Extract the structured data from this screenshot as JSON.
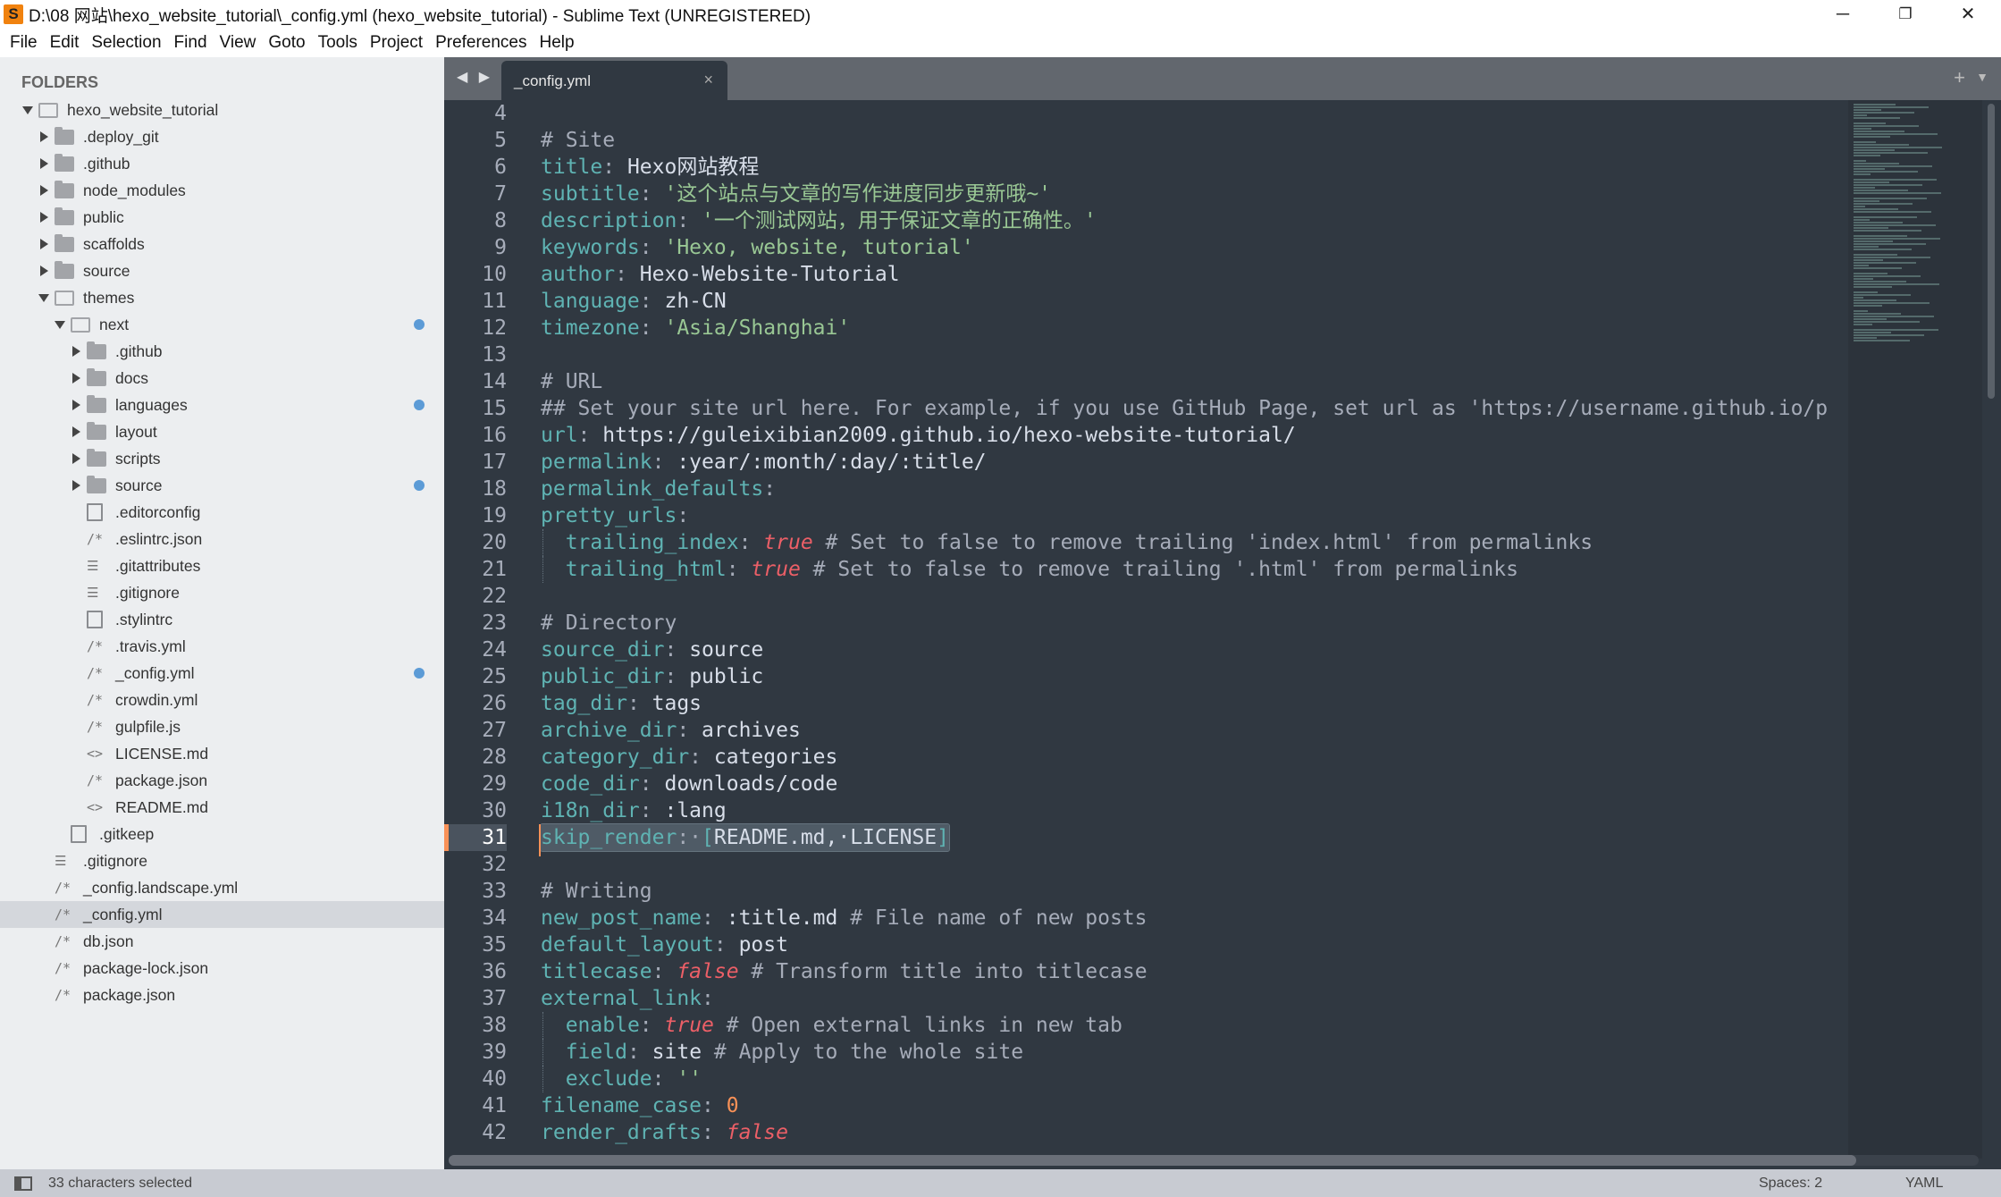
{
  "window": {
    "title": "D:\\08 网站\\hexo_website_tutorial\\_config.yml (hexo_website_tutorial) - Sublime Text (UNREGISTERED)",
    "app_icon": "S",
    "minimize": "─",
    "restore": "❐",
    "close": "✕"
  },
  "menu": [
    "File",
    "Edit",
    "Selection",
    "Find",
    "View",
    "Goto",
    "Tools",
    "Project",
    "Preferences",
    "Help"
  ],
  "sidebar": {
    "header": "FOLDERS",
    "items": [
      {
        "label": "hexo_website_tutorial",
        "level": 0,
        "type": "folder-open",
        "expanded": true
      },
      {
        "label": ".deploy_git",
        "level": 1,
        "type": "folder"
      },
      {
        "label": ".github",
        "level": 1,
        "type": "folder"
      },
      {
        "label": "node_modules",
        "level": 1,
        "type": "folder"
      },
      {
        "label": "public",
        "level": 1,
        "type": "folder"
      },
      {
        "label": "scaffolds",
        "level": 1,
        "type": "folder"
      },
      {
        "label": "source",
        "level": 1,
        "type": "folder"
      },
      {
        "label": "themes",
        "level": 1,
        "type": "folder-open",
        "expanded": true
      },
      {
        "label": "next",
        "level": 2,
        "type": "folder-open",
        "expanded": true,
        "modified": true
      },
      {
        "label": ".github",
        "level": 3,
        "type": "folder"
      },
      {
        "label": "docs",
        "level": 3,
        "type": "folder"
      },
      {
        "label": "languages",
        "level": 3,
        "type": "folder",
        "modified": true
      },
      {
        "label": "layout",
        "level": 3,
        "type": "folder"
      },
      {
        "label": "scripts",
        "level": 3,
        "type": "folder"
      },
      {
        "label": "source",
        "level": 3,
        "type": "folder",
        "modified": true
      },
      {
        "label": ".editorconfig",
        "level": 3,
        "type": "doc"
      },
      {
        "label": ".eslintrc.json",
        "level": 3,
        "type": "code",
        "glyph": "/*"
      },
      {
        "label": ".gitattributes",
        "level": 3,
        "type": "text",
        "glyph": "☰"
      },
      {
        "label": ".gitignore",
        "level": 3,
        "type": "text",
        "glyph": "☰"
      },
      {
        "label": ".stylintrc",
        "level": 3,
        "type": "doc"
      },
      {
        "label": ".travis.yml",
        "level": 3,
        "type": "code",
        "glyph": "/*"
      },
      {
        "label": "_config.yml",
        "level": 3,
        "type": "code",
        "glyph": "/*",
        "modified": true
      },
      {
        "label": "crowdin.yml",
        "level": 3,
        "type": "code",
        "glyph": "/*"
      },
      {
        "label": "gulpfile.js",
        "level": 3,
        "type": "code",
        "glyph": "/*"
      },
      {
        "label": "LICENSE.md",
        "level": 3,
        "type": "markup",
        "glyph": "<>"
      },
      {
        "label": "package.json",
        "level": 3,
        "type": "code",
        "glyph": "/*"
      },
      {
        "label": "README.md",
        "level": 3,
        "type": "markup",
        "glyph": "<>"
      },
      {
        "label": ".gitkeep",
        "level": 2,
        "type": "doc"
      },
      {
        "label": ".gitignore",
        "level": 1,
        "type": "text",
        "glyph": "☰"
      },
      {
        "label": "_config.landscape.yml",
        "level": 1,
        "type": "code",
        "glyph": "/*"
      },
      {
        "label": "_config.yml",
        "level": 1,
        "type": "code",
        "glyph": "/*",
        "selected": true
      },
      {
        "label": "db.json",
        "level": 1,
        "type": "code",
        "glyph": "/*"
      },
      {
        "label": "package-lock.json",
        "level": 1,
        "type": "code",
        "glyph": "/*"
      },
      {
        "label": "package.json",
        "level": 1,
        "type": "code",
        "glyph": "/*"
      }
    ]
  },
  "tabs": {
    "nav": "◀ ▶",
    "active": "_config.yml",
    "close": "×",
    "plus": "+",
    "menu": "▼"
  },
  "editor": {
    "current_line": 31,
    "lines": [
      {
        "n": 4,
        "t": []
      },
      {
        "n": 5,
        "t": [
          [
            "cmt",
            "# Site"
          ]
        ]
      },
      {
        "n": 6,
        "t": [
          [
            "key",
            "title"
          ],
          [
            "pun",
            ": "
          ],
          [
            "val",
            "Hexo网站教程"
          ]
        ]
      },
      {
        "n": 7,
        "t": [
          [
            "key",
            "subtitle"
          ],
          [
            "pun",
            ": "
          ],
          [
            "str",
            "'这个站点与文章的写作进度同步更新哦~'"
          ]
        ]
      },
      {
        "n": 8,
        "t": [
          [
            "key",
            "description"
          ],
          [
            "pun",
            ": "
          ],
          [
            "str",
            "'一个测试网站，用于保证文章的正确性。'"
          ]
        ]
      },
      {
        "n": 9,
        "t": [
          [
            "key",
            "keywords"
          ],
          [
            "pun",
            ": "
          ],
          [
            "str",
            "'Hexo, website, tutorial'"
          ]
        ]
      },
      {
        "n": 10,
        "t": [
          [
            "key",
            "author"
          ],
          [
            "pun",
            ": "
          ],
          [
            "val",
            "Hexo-Website-Tutorial"
          ]
        ]
      },
      {
        "n": 11,
        "t": [
          [
            "key",
            "language"
          ],
          [
            "pun",
            ": "
          ],
          [
            "val",
            "zh-CN"
          ]
        ]
      },
      {
        "n": 12,
        "t": [
          [
            "key",
            "timezone"
          ],
          [
            "pun",
            ": "
          ],
          [
            "str",
            "'Asia/Shanghai'"
          ]
        ]
      },
      {
        "n": 13,
        "t": []
      },
      {
        "n": 14,
        "t": [
          [
            "cmt",
            "# URL"
          ]
        ]
      },
      {
        "n": 15,
        "t": [
          [
            "cmt",
            "## Set your site url here. For example, if you use GitHub Page, set url as 'https://username.github.io/p"
          ]
        ]
      },
      {
        "n": 16,
        "t": [
          [
            "key",
            "url"
          ],
          [
            "pun",
            ": "
          ],
          [
            "val",
            "https://guleixibian2009.github.io/hexo-website-tutorial/"
          ]
        ]
      },
      {
        "n": 17,
        "t": [
          [
            "key",
            "permalink"
          ],
          [
            "pun",
            ": "
          ],
          [
            "val",
            ":year/:month/:day/:title/"
          ]
        ]
      },
      {
        "n": 18,
        "t": [
          [
            "key",
            "permalink_defaults"
          ],
          [
            "pun",
            ":"
          ]
        ]
      },
      {
        "n": 19,
        "t": [
          [
            "key",
            "pretty_urls"
          ],
          [
            "pun",
            ":"
          ]
        ]
      },
      {
        "n": 20,
        "indent": true,
        "t": [
          [
            "val",
            "  "
          ],
          [
            "key",
            "trailing_index"
          ],
          [
            "pun",
            ": "
          ],
          [
            "bool",
            "true"
          ],
          [
            "cmt",
            " # Set to false to remove trailing 'index.html' from permalinks"
          ]
        ]
      },
      {
        "n": 21,
        "indent": true,
        "t": [
          [
            "val",
            "  "
          ],
          [
            "key",
            "trailing_html"
          ],
          [
            "pun",
            ": "
          ],
          [
            "bool",
            "true"
          ],
          [
            "cmt",
            " # Set to false to remove trailing '.html' from permalinks"
          ]
        ]
      },
      {
        "n": 22,
        "t": []
      },
      {
        "n": 23,
        "t": [
          [
            "cmt",
            "# Directory"
          ]
        ]
      },
      {
        "n": 24,
        "t": [
          [
            "key",
            "source_dir"
          ],
          [
            "pun",
            ": "
          ],
          [
            "val",
            "source"
          ]
        ]
      },
      {
        "n": 25,
        "t": [
          [
            "key",
            "public_dir"
          ],
          [
            "pun",
            ": "
          ],
          [
            "val",
            "public"
          ]
        ]
      },
      {
        "n": 26,
        "t": [
          [
            "key",
            "tag_dir"
          ],
          [
            "pun",
            ": "
          ],
          [
            "val",
            "tags"
          ]
        ]
      },
      {
        "n": 27,
        "t": [
          [
            "key",
            "archive_dir"
          ],
          [
            "pun",
            ": "
          ],
          [
            "val",
            "archives"
          ]
        ]
      },
      {
        "n": 28,
        "t": [
          [
            "key",
            "category_dir"
          ],
          [
            "pun",
            ": "
          ],
          [
            "val",
            "categories"
          ]
        ]
      },
      {
        "n": 29,
        "t": [
          [
            "key",
            "code_dir"
          ],
          [
            "pun",
            ": "
          ],
          [
            "val",
            "downloads/code"
          ]
        ]
      },
      {
        "n": 30,
        "t": [
          [
            "key",
            "i18n_dir"
          ],
          [
            "pun",
            ": "
          ],
          [
            "val",
            ":lang"
          ]
        ]
      },
      {
        "n": 31,
        "selected": true,
        "t": [
          [
            "key",
            "skip_render"
          ],
          [
            "pun",
            ":·"
          ],
          [
            "key",
            "["
          ],
          [
            "val",
            "README.md,·LICENSE"
          ],
          [
            "key",
            "]"
          ]
        ]
      },
      {
        "n": 32,
        "t": []
      },
      {
        "n": 33,
        "t": [
          [
            "cmt",
            "# Writing"
          ]
        ]
      },
      {
        "n": 34,
        "t": [
          [
            "key",
            "new_post_name"
          ],
          [
            "pun",
            ": "
          ],
          [
            "val",
            ":title.md"
          ],
          [
            "cmt",
            " # File name of new posts"
          ]
        ]
      },
      {
        "n": 35,
        "t": [
          [
            "key",
            "default_layout"
          ],
          [
            "pun",
            ": "
          ],
          [
            "val",
            "post"
          ]
        ]
      },
      {
        "n": 36,
        "t": [
          [
            "key",
            "titlecase"
          ],
          [
            "pun",
            ": "
          ],
          [
            "bool",
            "false"
          ],
          [
            "cmt",
            " # Transform title into titlecase"
          ]
        ]
      },
      {
        "n": 37,
        "t": [
          [
            "key",
            "external_link"
          ],
          [
            "pun",
            ":"
          ]
        ]
      },
      {
        "n": 38,
        "indent": true,
        "t": [
          [
            "val",
            "  "
          ],
          [
            "key",
            "enable"
          ],
          [
            "pun",
            ": "
          ],
          [
            "bool",
            "true"
          ],
          [
            "cmt",
            " # Open external links in new tab"
          ]
        ]
      },
      {
        "n": 39,
        "indent": true,
        "t": [
          [
            "val",
            "  "
          ],
          [
            "key",
            "field"
          ],
          [
            "pun",
            ": "
          ],
          [
            "val",
            "site"
          ],
          [
            "cmt",
            " # Apply to the whole site"
          ]
        ]
      },
      {
        "n": 40,
        "indent": true,
        "t": [
          [
            "val",
            "  "
          ],
          [
            "key",
            "exclude"
          ],
          [
            "pun",
            ": "
          ],
          [
            "str",
            "''"
          ]
        ]
      },
      {
        "n": 41,
        "t": [
          [
            "key",
            "filename_case"
          ],
          [
            "pun",
            ": "
          ],
          [
            "num",
            "0"
          ]
        ]
      },
      {
        "n": 42,
        "t": [
          [
            "key",
            "render_drafts"
          ],
          [
            "pun",
            ": "
          ],
          [
            "bool",
            "false"
          ]
        ]
      }
    ]
  },
  "statusbar": {
    "selection": "33 characters selected",
    "indent": "Spaces: 2",
    "syntax": "YAML"
  },
  "colors": {
    "editor_bg": "#303841",
    "key": "#5fb3b3",
    "string": "#99c794",
    "bool": "#ec5f67",
    "number": "#f99157",
    "sidebar_bg": "#eceef0",
    "modified_dot": "#5c9bd6"
  }
}
